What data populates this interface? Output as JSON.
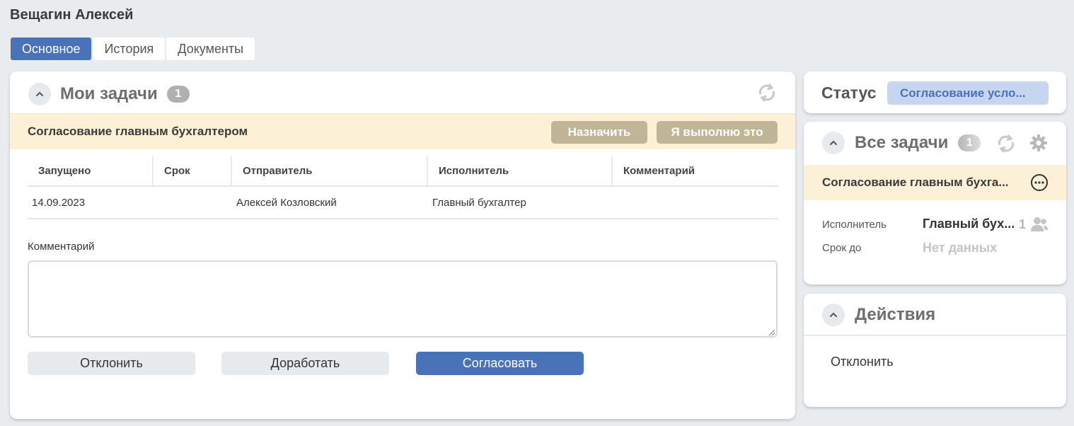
{
  "page": {
    "title": "Вещагин Алексей"
  },
  "tabs": [
    {
      "label": "Основное",
      "active": true
    },
    {
      "label": "История",
      "active": false
    },
    {
      "label": "Документы",
      "active": false
    }
  ],
  "my_tasks": {
    "title": "Мои задачи",
    "count": "1",
    "task_title": "Согласование главным бухгалтером",
    "assign_label": "Назначить",
    "do_it_label": "Я выполню это",
    "table": {
      "headers": [
        "Запущено",
        "Срок",
        "Отправитель",
        "Исполнитель",
        "Комментарий"
      ],
      "rows": [
        [
          "14.09.2023",
          "",
          "Алексей Козловский",
          "Главный бухгалтер",
          ""
        ]
      ]
    },
    "comment_label": "Комментарий",
    "comment_value": "",
    "buttons": {
      "reject": "Отклонить",
      "rework": "Доработать",
      "approve": "Согласовать"
    }
  },
  "status": {
    "label": "Статус",
    "value": "Согласование усло..."
  },
  "all_tasks": {
    "title": "Все задачи",
    "count": "1",
    "task_title": "Согласование главным бухга...",
    "executor_label": "Исполнитель",
    "executor_value": "Главный бух...",
    "executor_count": "1",
    "deadline_label": "Срок до",
    "deadline_value": "Нет данных"
  },
  "actions": {
    "title": "Действия",
    "items": [
      "Отклонить"
    ]
  },
  "colors": {
    "accent": "#4a72b8",
    "task_bar": "#fcf1d6",
    "bar_button": "#c0b597",
    "status_badge_bg": "#c7d6f0"
  },
  "icons": [
    "chevron-up-icon",
    "refresh-icon",
    "gear-icon",
    "more-icon",
    "people-icon",
    "resize-grip-icon"
  ]
}
